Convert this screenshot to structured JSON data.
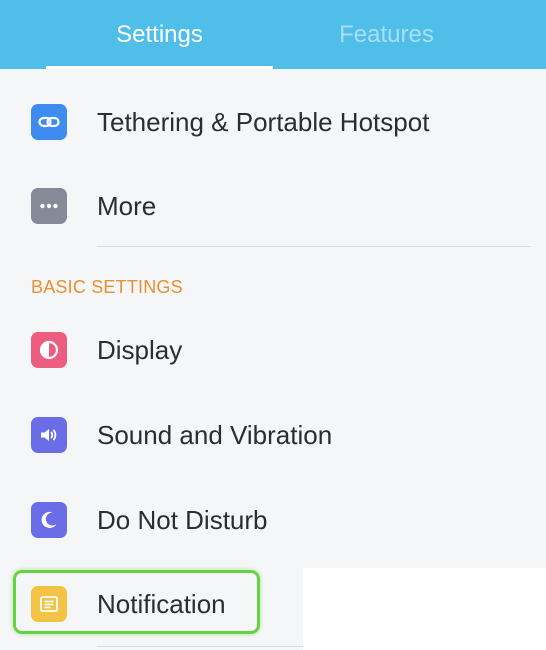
{
  "tabs": {
    "settings_label": "Settings",
    "features_label": "Features"
  },
  "network": {
    "tethering_label": "Tethering & Portable Hotspot",
    "more_label": "More"
  },
  "basic_settings": {
    "header": "BASIC SETTINGS",
    "display_label": "Display",
    "sound_label": "Sound and Vibration",
    "dnd_label": "Do Not Disturb",
    "notification_label": "Notification"
  },
  "colors": {
    "tab_bar": "#4fbfe9",
    "section_header": "#e99031",
    "tethering_icon": "#3e8cf0",
    "more_icon": "#858a99",
    "display_icon": "#ed5d80",
    "sound_icon": "#6a6de6",
    "dnd_icon": "#6a6de6",
    "notification_icon": "#f2c344",
    "highlight": "#66d23f"
  },
  "icons": {
    "tethering": "link-icon",
    "more": "more-dots-icon",
    "display": "contrast-icon",
    "sound": "speaker-icon",
    "dnd": "moon-icon",
    "notification": "notification-list-icon"
  }
}
